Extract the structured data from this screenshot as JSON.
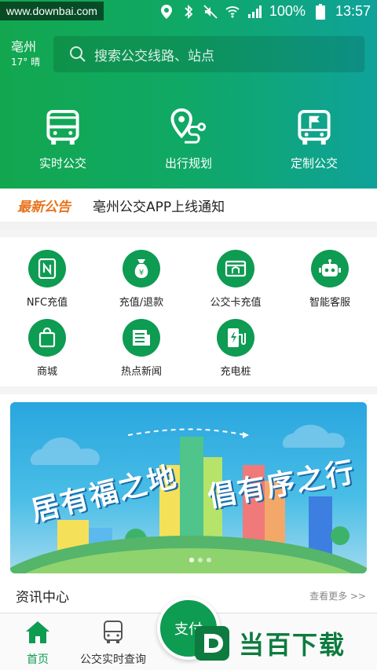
{
  "status_bar": {
    "watermark": "www.downbai.com",
    "battery": "100%",
    "time": "13:57"
  },
  "header": {
    "city": "亳州",
    "weather": "17° 晴",
    "search_placeholder": "搜索公交线路、站点",
    "actions": [
      {
        "label": "实时公交",
        "icon": "bus-icon"
      },
      {
        "label": "出行规划",
        "icon": "route-plan-icon"
      },
      {
        "label": "定制公交",
        "icon": "custom-bus-icon"
      }
    ]
  },
  "notice": {
    "tag": "最新公告",
    "text": "亳州公交APP上线通知"
  },
  "services": [
    {
      "label": "NFC充值",
      "icon": "nfc-icon"
    },
    {
      "label": "充值/退款",
      "icon": "money-bag-icon"
    },
    {
      "label": "公交卡充值",
      "icon": "card-icon"
    },
    {
      "label": "智能客服",
      "icon": "robot-icon"
    },
    {
      "label": "商城",
      "icon": "shopping-bag-icon"
    },
    {
      "label": "热点新闻",
      "icon": "newspaper-icon"
    },
    {
      "label": "充电桩",
      "icon": "charging-pile-icon"
    }
  ],
  "banner": {
    "line1": "居有福之地",
    "line2": "倡有序之行"
  },
  "news": {
    "title": "资讯中心",
    "more": "查看更多 >>"
  },
  "bottom_nav": {
    "home": "首页",
    "realtime": "公交实时查询",
    "pay": "支付"
  },
  "brand_watermark": "当百下载",
  "colors": {
    "primary_green": "#0e9b52",
    "notice_orange": "#e8731c"
  }
}
